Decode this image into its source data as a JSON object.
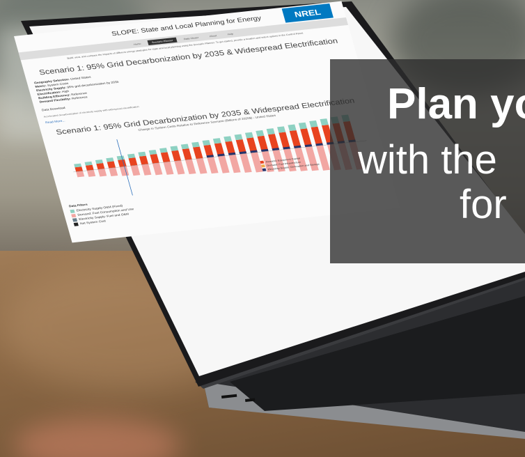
{
  "app": {
    "title": "SLOPE: State and Local Planning for Energy",
    "logo": "NREL"
  },
  "nav": {
    "tabs": [
      "Home",
      "Scenario Planner",
      "Data Viewer",
      "About",
      "Help"
    ],
    "active_index": 1,
    "login": "Log In"
  },
  "intro": "Build, view, and compare the impacts of different energy strategies for state and local planning using the Scenario Planner. To get started, provide a location and select options in the Control Panel.",
  "scenario": {
    "title": "Scenario 1: 95% Grid Decarbonization by 2035 & Widespread Electrification",
    "meta": [
      {
        "label": "Geography Selection:",
        "value": "United States"
      },
      {
        "label": "Metric:",
        "value": "System Costs"
      },
      {
        "label": "Electricity Supply:",
        "value": "95% grid decarbonization by 2035"
      },
      {
        "label": "Electrification:",
        "value": "High"
      },
      {
        "label": "Building Efficiency:",
        "value": "Reference"
      },
      {
        "label": "Demand Flexibility:",
        "value": "Reference"
      }
    ],
    "download": "Data Download",
    "description": "Accelerated decarbonization of electricity supply with widespread electrification",
    "read_more": "Read More..."
  },
  "chart": {
    "title": "Scenario 1: 95% Grid Decarbonization by 2035 & Widespread Electrification",
    "subtitle": "Change in System Costs Relative to Reference Scenario (Billions of 2020$) - United States"
  },
  "filters": {
    "heading": "Data Filters",
    "items": [
      {
        "label": "Electricity Supply O&M (Fixed)",
        "color": "#8ed1c2"
      },
      {
        "label": "Demand: Fuel Consumption and Use",
        "color": "#f2a7a3"
      },
      {
        "label": "Electricity Supply: Fuel and O&M",
        "color": "#6a7f8c"
      },
      {
        "label": "Net System Cost",
        "color": "#222222"
      }
    ]
  },
  "legend": {
    "items": [
      {
        "label": "Demand: Equipment Capital",
        "color": "#e8431f"
      },
      {
        "label": "Demand: Fuel Infrastructure",
        "color": "#f1a94a"
      },
      {
        "label": "Electricity Supply: Generation and Storage",
        "color": "#25336b"
      }
    ]
  },
  "overlay": {
    "line1": "Plan yo",
    "line2": "with the",
    "line3": "for"
  }
}
